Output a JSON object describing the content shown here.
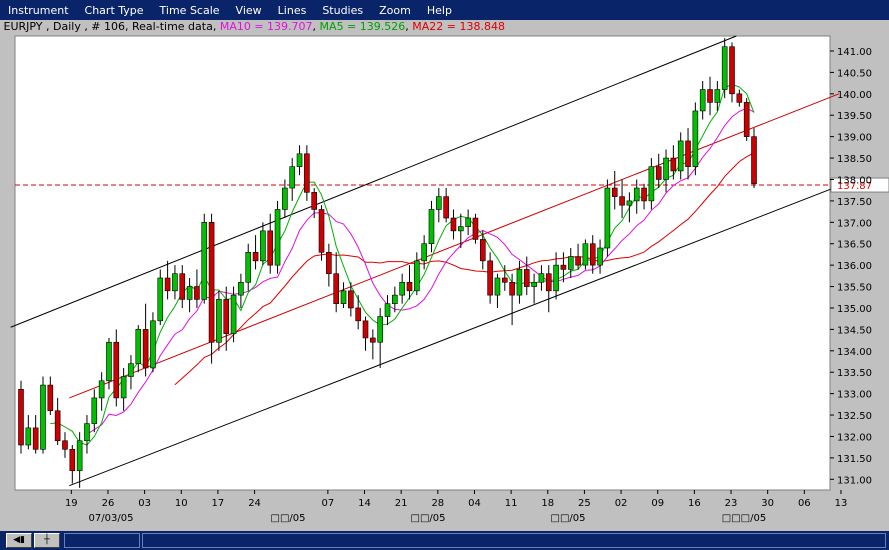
{
  "menu": [
    "Instrument",
    "Chart Type",
    "Time Scale",
    "View",
    "Lines",
    "Studies",
    "Zoom",
    "Help"
  ],
  "legend": {
    "instrument": "EURJPY , Daily , # 106, Real-time data",
    "ma10": "MA10 = 139.707",
    "ma5": "MA5 = 139.526",
    "ma22": "MA22 = 138.848"
  },
  "colors": {
    "ma10": "#e010e0",
    "ma5": "#00b000",
    "ma22": "#e00000",
    "up": "#00c000",
    "down": "#cc0000",
    "hline": "#e00000",
    "channel": "#000000",
    "trend": "#cc0000"
  },
  "chart_data": {
    "type": "candlestick",
    "ylim": [
      130.75,
      141.35
    ],
    "yticks": [
      "131.00",
      "131.50",
      "132.00",
      "132.50",
      "133.00",
      "133.50",
      "134.00",
      "134.50",
      "135.00",
      "135.50",
      "136.00",
      "136.50",
      "137.00",
      "137.50",
      "138.00",
      "138.50",
      "139.00",
      "139.50",
      "140.00",
      "140.50",
      "141.00"
    ],
    "xticks": [
      "19",
      "26",
      "03",
      "10",
      "17",
      "24",
      "07",
      "14",
      "21",
      "28",
      "04",
      "11",
      "18",
      "25",
      "02",
      "09",
      "16",
      "23",
      "30",
      "06",
      "13"
    ],
    "date_labels": [
      "07/03/05",
      "□□/05",
      "□□/05",
      "□□/05",
      "□□□/05"
    ],
    "hline": {
      "value": 137.87,
      "label": "137.87"
    },
    "candles": [
      [
        133.1,
        133.3,
        131.6,
        131.8
      ],
      [
        131.8,
        132.5,
        131.7,
        132.2
      ],
      [
        132.2,
        132.5,
        131.6,
        131.7
      ],
      [
        131.7,
        133.4,
        131.6,
        133.2
      ],
      [
        133.2,
        133.4,
        132.5,
        132.6
      ],
      [
        132.6,
        132.9,
        131.8,
        131.9
      ],
      [
        131.9,
        132.1,
        131.5,
        131.7
      ],
      [
        131.7,
        131.8,
        130.9,
        131.2
      ],
      [
        131.2,
        132.1,
        130.8,
        131.9
      ],
      [
        131.9,
        132.5,
        131.6,
        132.3
      ],
      [
        132.3,
        133.1,
        132.1,
        132.9
      ],
      [
        132.9,
        133.5,
        132.6,
        133.3
      ],
      [
        133.3,
        134.3,
        133.1,
        134.2
      ],
      [
        134.2,
        134.5,
        132.7,
        132.9
      ],
      [
        132.9,
        133.6,
        132.6,
        133.4
      ],
      [
        133.4,
        133.9,
        133.1,
        133.7
      ],
      [
        133.7,
        134.6,
        133.5,
        134.5
      ],
      [
        134.5,
        135.1,
        133.4,
        133.6
      ],
      [
        133.6,
        134.9,
        133.5,
        134.7
      ],
      [
        134.7,
        135.9,
        134.6,
        135.7
      ],
      [
        135.7,
        136.1,
        135.2,
        135.4
      ],
      [
        135.4,
        136.0,
        135.2,
        135.8
      ],
      [
        135.8,
        136.0,
        135.0,
        135.2
      ],
      [
        135.2,
        135.7,
        134.9,
        135.5
      ],
      [
        135.5,
        135.9,
        135.0,
        135.2
      ],
      [
        135.2,
        137.2,
        135.1,
        137.0
      ],
      [
        137.0,
        137.2,
        133.7,
        134.2
      ],
      [
        134.2,
        135.4,
        134.0,
        135.2
      ],
      [
        135.2,
        135.5,
        134.0,
        134.4
      ],
      [
        134.4,
        135.5,
        134.2,
        135.3
      ],
      [
        135.3,
        135.8,
        135.0,
        135.6
      ],
      [
        135.6,
        136.5,
        135.4,
        136.3
      ],
      [
        136.3,
        136.7,
        135.9,
        136.1
      ],
      [
        136.1,
        137.0,
        136.0,
        136.8
      ],
      [
        136.8,
        137.2,
        135.8,
        136.0
      ],
      [
        136.0,
        137.5,
        135.8,
        137.3
      ],
      [
        137.3,
        138.0,
        137.1,
        137.8
      ],
      [
        137.8,
        138.5,
        137.5,
        138.3
      ],
      [
        138.3,
        138.8,
        138.1,
        138.6
      ],
      [
        138.6,
        138.8,
        137.5,
        137.7
      ],
      [
        137.7,
        137.8,
        137.1,
        137.3
      ],
      [
        137.3,
        137.4,
        136.1,
        136.3
      ],
      [
        136.3,
        136.5,
        135.5,
        135.8
      ],
      [
        135.8,
        136.3,
        134.9,
        135.1
      ],
      [
        135.1,
        135.6,
        135.0,
        135.4
      ],
      [
        135.4,
        135.6,
        134.8,
        135.0
      ],
      [
        135.0,
        135.3,
        134.5,
        134.7
      ],
      [
        134.7,
        134.8,
        134.0,
        134.3
      ],
      [
        134.3,
        134.5,
        133.8,
        134.2
      ],
      [
        134.2,
        135.0,
        133.6,
        134.8
      ],
      [
        134.8,
        135.3,
        134.6,
        135.1
      ],
      [
        135.1,
        135.5,
        134.9,
        135.3
      ],
      [
        135.3,
        135.8,
        135.1,
        135.6
      ],
      [
        135.6,
        136.0,
        135.2,
        135.4
      ],
      [
        135.4,
        136.3,
        135.3,
        136.1
      ],
      [
        136.1,
        136.7,
        135.9,
        136.5
      ],
      [
        136.5,
        137.5,
        136.3,
        137.3
      ],
      [
        137.3,
        137.8,
        137.0,
        137.6
      ],
      [
        137.6,
        137.8,
        137.0,
        137.1
      ],
      [
        137.1,
        137.3,
        136.6,
        136.8
      ],
      [
        136.8,
        137.2,
        136.4,
        136.9
      ],
      [
        136.9,
        137.3,
        136.7,
        137.1
      ],
      [
        137.1,
        137.2,
        136.5,
        136.6
      ],
      [
        136.6,
        136.8,
        135.9,
        136.1
      ],
      [
        136.1,
        136.3,
        135.1,
        135.3
      ],
      [
        135.3,
        135.8,
        135.0,
        135.7
      ],
      [
        135.7,
        136.0,
        135.4,
        135.6
      ],
      [
        135.6,
        135.8,
        134.6,
        135.3
      ],
      [
        135.3,
        136.1,
        135.1,
        135.9
      ],
      [
        135.9,
        136.2,
        135.3,
        135.5
      ],
      [
        135.5,
        135.8,
        135.1,
        135.6
      ],
      [
        135.6,
        136.0,
        135.4,
        135.8
      ],
      [
        135.8,
        136.0,
        134.9,
        135.4
      ],
      [
        135.4,
        136.3,
        135.2,
        136.0
      ],
      [
        136.0,
        136.3,
        135.6,
        135.9
      ],
      [
        135.9,
        136.4,
        135.7,
        136.2
      ],
      [
        136.2,
        136.5,
        135.9,
        136.0
      ],
      [
        136.0,
        136.6,
        135.9,
        136.5
      ],
      [
        136.5,
        136.7,
        135.8,
        136.0
      ],
      [
        136.0,
        136.6,
        135.8,
        136.4
      ],
      [
        136.4,
        138.0,
        136.2,
        137.8
      ],
      [
        137.8,
        138.2,
        137.3,
        137.6
      ],
      [
        137.6,
        138.0,
        137.1,
        137.4
      ],
      [
        137.4,
        137.7,
        137.0,
        137.5
      ],
      [
        137.5,
        138.0,
        137.2,
        137.8
      ],
      [
        137.8,
        137.9,
        137.3,
        137.5
      ],
      [
        137.5,
        138.5,
        137.3,
        138.3
      ],
      [
        138.3,
        138.6,
        137.8,
        138.0
      ],
      [
        138.0,
        138.7,
        137.7,
        138.5
      ],
      [
        138.5,
        138.8,
        138.0,
        138.2
      ],
      [
        138.2,
        139.1,
        138.0,
        138.9
      ],
      [
        138.9,
        139.2,
        138.0,
        138.3
      ],
      [
        138.3,
        139.8,
        138.1,
        139.6
      ],
      [
        139.6,
        140.3,
        139.4,
        140.1
      ],
      [
        140.1,
        140.4,
        139.5,
        139.8
      ],
      [
        139.8,
        140.3,
        139.6,
        140.1
      ],
      [
        140.1,
        141.3,
        139.9,
        141.1
      ],
      [
        141.1,
        141.2,
        139.8,
        140.0
      ],
      [
        140.0,
        140.1,
        139.7,
        139.8
      ],
      [
        139.8,
        139.9,
        138.9,
        139.0
      ],
      [
        139.0,
        139.2,
        137.8,
        137.9
      ]
    ]
  }
}
